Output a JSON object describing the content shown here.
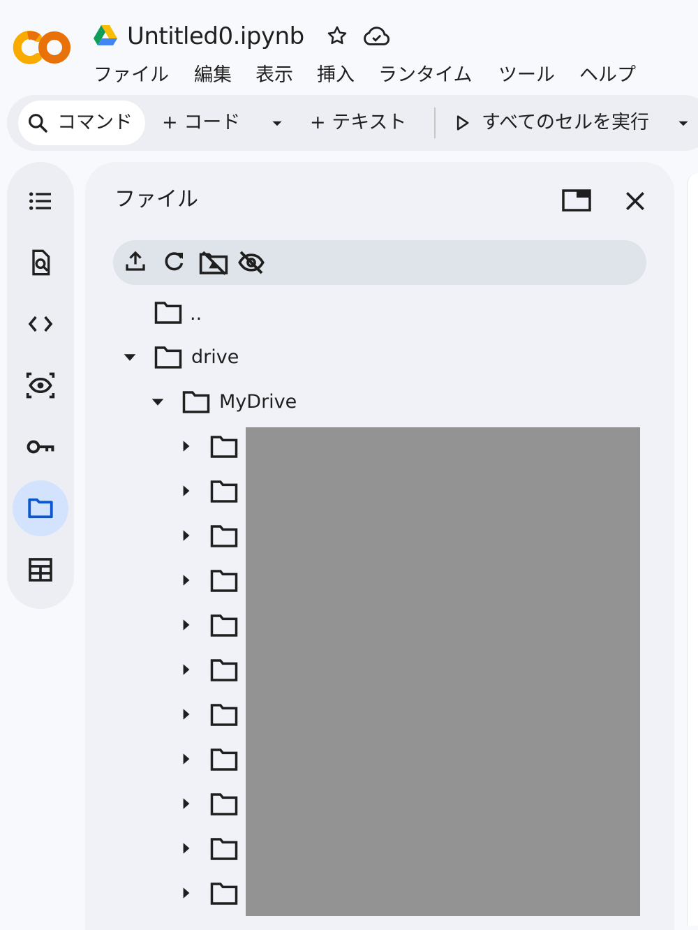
{
  "app": {
    "title": "Untitled0.ipynb",
    "logo_text": "CO",
    "brand_colors": {
      "orange": "#e8710a",
      "yellow": "#f9ab00"
    }
  },
  "menu": [
    "ファイル",
    "編集",
    "表示",
    "挿入",
    "ランタイム",
    "ツール",
    "ヘルプ"
  ],
  "toolbar": {
    "command_label": "コマンド",
    "add_code_label": "+ コード",
    "add_text_label": "+ テキスト",
    "run_all_label": "すべてのセルを実行"
  },
  "sidebar": {
    "items": [
      {
        "name": "toc",
        "icon": "table-of-contents-icon"
      },
      {
        "name": "find",
        "icon": "find-replace-icon"
      },
      {
        "name": "code-snippets",
        "icon": "code-icon"
      },
      {
        "name": "variables",
        "icon": "variables-eye-icon"
      },
      {
        "name": "secrets",
        "icon": "key-icon"
      },
      {
        "name": "files",
        "icon": "folder-icon",
        "active": true
      },
      {
        "name": "data-tables",
        "icon": "table-icon"
      }
    ]
  },
  "files_panel": {
    "title": "ファイル",
    "toolbar_icons": [
      "upload-icon",
      "refresh-icon",
      "unmount-drive-icon",
      "hide-hidden-icon"
    ],
    "tree": {
      "parent_label": "..",
      "drive_label": "drive",
      "mydrive_label": "MyDrive",
      "collapsed_child_folders": 11,
      "child_names_redacted": true
    }
  }
}
